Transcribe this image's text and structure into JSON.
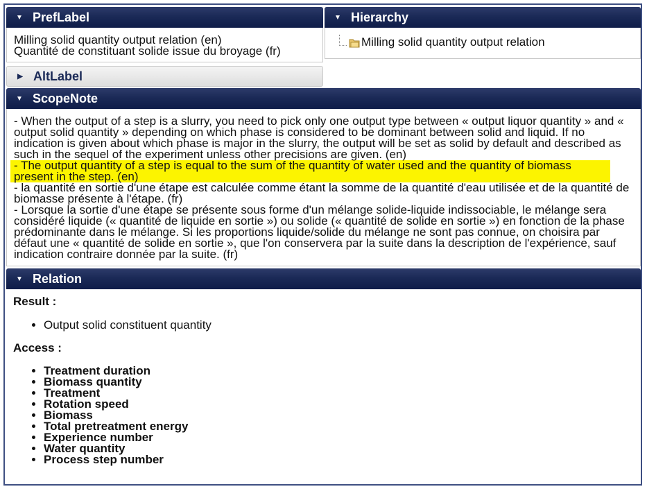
{
  "panels": {
    "preflabel": {
      "title": "PrefLabel",
      "lines": [
        "Milling solid quantity output relation (en)",
        "Quantité de constituant solide issue du broyage (fr)"
      ]
    },
    "hierarchy": {
      "title": "Hierarchy",
      "item": "Milling solid quantity output relation"
    },
    "altlabel": {
      "title": "AltLabel"
    },
    "scopenote": {
      "title": "ScopeNote",
      "paragraphs": [
        "- When the output of a step is a slurry, you need to pick only one output type between « output liquor quantity » and « output solid quantity » depending on which phase is considered to be dominant between solid and liquid. If no indication is given about which phase is major in the slurry, the output will be set as solid by default and described as such in the sequel of the experiment unless other precisions are given.  (en)",
        "- The output quantity of a step is equal to the sum of the quantity of water used and the quantity of biomass present in the step. (en)",
        "- la quantité en sortie d'une étape est calculée comme étant la somme de la quantité d'eau utilisée et de la quantité de biomasse présente à l'étape. (fr)",
        "- Lorsque la sortie d'une étape se présente sous forme d'un mélange solide-liquide indissociable, le mélange sera considéré liquide (« quantité de liquide en sortie ») ou solide (« quantité de solide en sortie ») en fonction de la phase prédominante dans le mélange. Si les proportions liquide/solide du mélange ne sont pas connue, on choisira par défaut une « quantité de solide en sortie », que l'on conservera par la suite dans la description de l'expérience, sauf indication contraire donnée par la suite.  (fr)"
      ]
    },
    "relation": {
      "title": "Relation",
      "result_label": "Result :",
      "result_items": [
        "Output solid constituent quantity"
      ],
      "access_label": "Access :",
      "access_items": [
        "Treatment duration",
        "Biomass quantity",
        "Treatment",
        "Rotation speed",
        "Biomass",
        "Total pretreatment energy",
        "Experience number",
        "Water quantity",
        "Process step number"
      ]
    }
  },
  "icons": {
    "expanded": "triangle-down-icon",
    "collapsed": "triangle-right-icon",
    "folder": "folder-icon"
  },
  "colors": {
    "header_bg": "#1b2a57",
    "highlight": "#fcf400",
    "frame_border": "#3e4f82"
  }
}
